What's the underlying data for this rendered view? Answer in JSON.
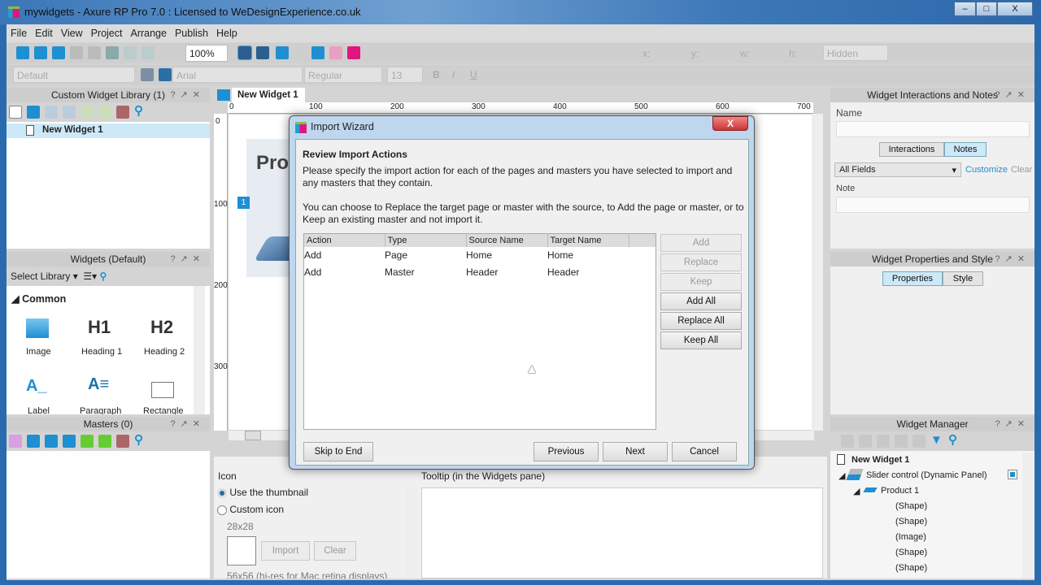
{
  "window": {
    "title": "mywidgets - Axure RP Pro 7.0 : Licensed to WeDesignExperience.co.uk",
    "minimize": "–",
    "maximize": "□",
    "close": "X"
  },
  "menu": [
    "File",
    "Edit",
    "View",
    "Project",
    "Arrange",
    "Publish",
    "Help"
  ],
  "toolbar": {
    "zoom": "100%",
    "style": "Default",
    "font": "Arial",
    "weight": "Regular",
    "size": "13",
    "x": "x:",
    "y": "y:",
    "w": "w:",
    "h": "h:",
    "hidden": "Hidden",
    "bold": "B",
    "italic": "I",
    "underline": "U"
  },
  "left": {
    "library_title": "Custom Widget Library (1)",
    "library_item": "New Widget 1",
    "widgets_title": "Widgets (Default)",
    "select_library": "Select Library",
    "common": "Common",
    "widgets": [
      {
        "glyph": "",
        "label": "Image"
      },
      {
        "glyph": "H1",
        "label": "Heading 1"
      },
      {
        "glyph": "H2",
        "label": "Heading 2"
      },
      {
        "glyph": "A_",
        "label": "Label"
      },
      {
        "glyph": "A≡",
        "label": "Paragraph"
      },
      {
        "glyph": "",
        "label": "Rectangle"
      }
    ],
    "masters_title": "Masters (0)"
  },
  "center": {
    "tab": "New Widget 1",
    "ruler_x": [
      "0",
      "100",
      "200",
      "300",
      "400",
      "500",
      "600",
      "700"
    ],
    "ruler_y": [
      "0",
      "100",
      "200",
      "300"
    ],
    "canvas_heading": "Pro",
    "badge": "1"
  },
  "bottom": {
    "icon_label": "Icon",
    "opt1": "Use the thumbnail",
    "opt2": "Custom icon",
    "size1": "28x28",
    "import": "Import",
    "clear": "Clear",
    "size2": "56x56 (hi-res for Mac retina displays)",
    "tooltip_label": "Tooltip (in the Widgets pane)"
  },
  "right": {
    "interactions_title": "Widget Interactions and Notes",
    "name_label": "Name",
    "tab_interactions": "Interactions",
    "tab_notes": "Notes",
    "fields_select": "All Fields",
    "customize": "Customize",
    "clear": "Clear All",
    "note_label": "Note",
    "props_title": "Widget Properties and Style",
    "tab_properties": "Properties",
    "tab_style": "Style",
    "manager_title": "Widget Manager",
    "tree": [
      {
        "label": "New Widget 1",
        "level": 0
      },
      {
        "label": "Slider control (Dynamic Panel)",
        "level": 1
      },
      {
        "label": "Product 1",
        "level": 2
      },
      {
        "label": "(Shape)",
        "level": 3
      },
      {
        "label": "(Shape)",
        "level": 3
      },
      {
        "label": "(Image)",
        "level": 3
      },
      {
        "label": "(Shape)",
        "level": 3
      },
      {
        "label": "(Shape)",
        "level": 3
      }
    ]
  },
  "dialog": {
    "title": "Import Wizard",
    "heading": "Review Import Actions",
    "para1": "Please specify the import action for each of the pages and masters you have selected to import and any masters that they contain.",
    "para2": "You can choose to Replace the target page or master with the source, to Add the page or master, or to Keep an existing master and not import it.",
    "columns": [
      "Action",
      "Type",
      "Source Name",
      "Target Name"
    ],
    "rows": [
      [
        "Add",
        "Page",
        "Home",
        "Home"
      ],
      [
        "Add",
        "Master",
        "Header",
        "Header"
      ]
    ],
    "side_buttons": [
      "Add",
      "Replace",
      "Keep",
      "Add All",
      "Replace All",
      "Keep All"
    ],
    "skip": "Skip to End",
    "previous": "Previous",
    "next": "Next",
    "cancel": "Cancel"
  },
  "colors": {
    "accent": "#1ea0d6",
    "brand_pink": "#e0157f",
    "selection": "#cde8f7"
  }
}
